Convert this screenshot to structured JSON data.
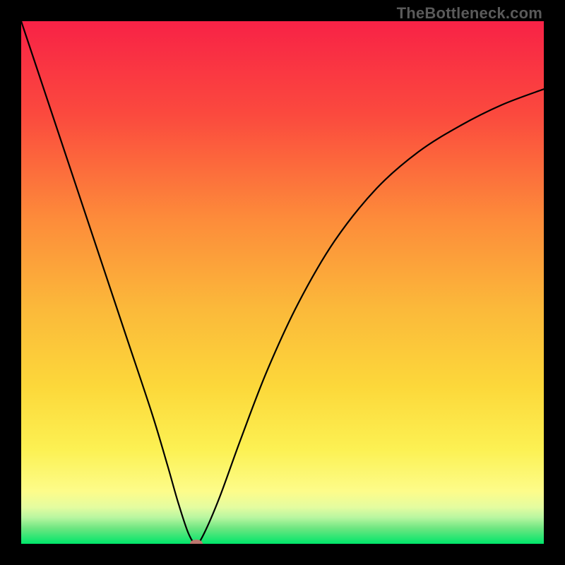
{
  "watermark": "TheBottleneck.com",
  "chart_data": {
    "type": "line",
    "title": "",
    "xlabel": "",
    "ylabel": "",
    "xlim": [
      0,
      1
    ],
    "ylim": [
      0,
      1
    ],
    "curve_points": [
      {
        "x": 0.0,
        "y": 1.0
      },
      {
        "x": 0.05,
        "y": 0.85
      },
      {
        "x": 0.1,
        "y": 0.7
      },
      {
        "x": 0.15,
        "y": 0.55
      },
      {
        "x": 0.2,
        "y": 0.4
      },
      {
        "x": 0.25,
        "y": 0.25
      },
      {
        "x": 0.28,
        "y": 0.15
      },
      {
        "x": 0.3,
        "y": 0.08
      },
      {
        "x": 0.32,
        "y": 0.02
      },
      {
        "x": 0.335,
        "y": 0.0
      },
      {
        "x": 0.35,
        "y": 0.02
      },
      {
        "x": 0.38,
        "y": 0.09
      },
      {
        "x": 0.42,
        "y": 0.2
      },
      {
        "x": 0.47,
        "y": 0.33
      },
      {
        "x": 0.53,
        "y": 0.46
      },
      {
        "x": 0.6,
        "y": 0.58
      },
      {
        "x": 0.68,
        "y": 0.68
      },
      {
        "x": 0.76,
        "y": 0.75
      },
      {
        "x": 0.84,
        "y": 0.8
      },
      {
        "x": 0.92,
        "y": 0.84
      },
      {
        "x": 1.0,
        "y": 0.87
      }
    ],
    "minimum_point": {
      "x": 0.335,
      "y": 0.0
    },
    "gradient_colors": {
      "top": "#f82246",
      "mid_upper": "#fd8c3a",
      "mid": "#fcd83a",
      "mid_lower": "#fdfc8a",
      "bottom_band": "#6fe681",
      "bottom": "#00e66a"
    },
    "curve_color": "#000000",
    "marker_color": "#bd766e"
  }
}
